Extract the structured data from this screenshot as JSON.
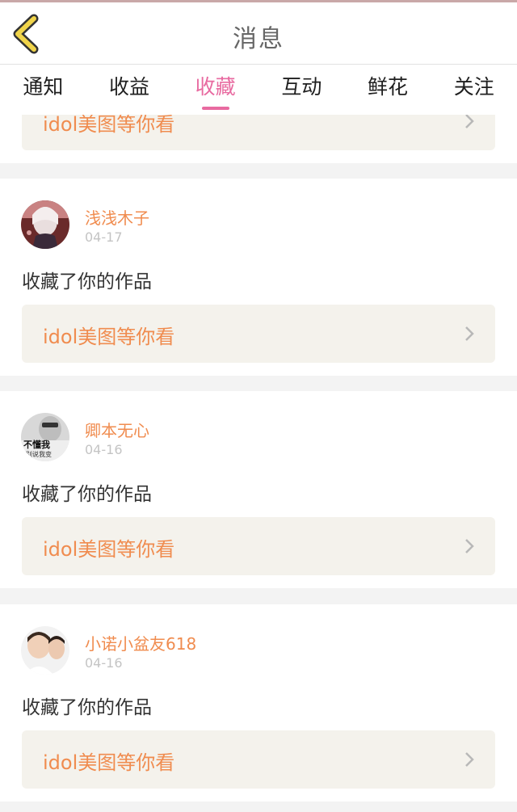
{
  "header": {
    "title": "消息"
  },
  "tabs": [
    {
      "label": "通知"
    },
    {
      "label": "收益"
    },
    {
      "label": "收藏",
      "active": true
    },
    {
      "label": "互动"
    },
    {
      "label": "鲜花"
    },
    {
      "label": "关注"
    }
  ],
  "feed": {
    "partial_item": {
      "link_text": "idol美图等你看"
    },
    "items": [
      {
        "username": "浅浅木子",
        "date": "04-17",
        "action": "收藏了你的作品",
        "link_text": "idol美图等你看"
      },
      {
        "username": "卿本无心",
        "date": "04-16",
        "action": "收藏了你的作品",
        "link_text": "idol美图等你看",
        "avatar_caption": [
          "不懂我",
          "别说我变"
        ]
      },
      {
        "username": "小诺小盆友618",
        "date": "04-16",
        "action": "收藏了你的作品",
        "link_text": "idol美图等你看"
      }
    ]
  },
  "colors": {
    "accent_pink": "#e86aa0",
    "username_orange": "#f08c4f",
    "back_arrow_yellow": "#f0d44a"
  }
}
